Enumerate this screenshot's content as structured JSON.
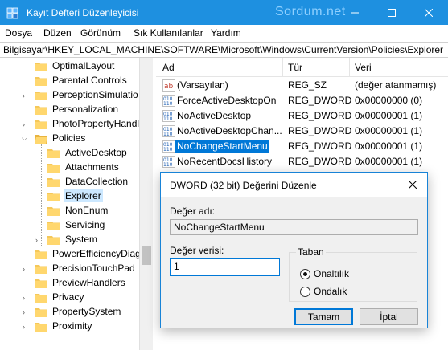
{
  "window": {
    "title": "Kayıt Defteri Düzenleyicisi",
    "watermark": "Sordum.net"
  },
  "menu": [
    "Dosya",
    "Düzen",
    "Görünüm",
    "Sık Kullanılanlar",
    "Yardım"
  ],
  "address": "Bilgisayar\\HKEY_LOCAL_MACHINE\\SOFTWARE\\Microsoft\\Windows\\CurrentVersion\\Policies\\Explorer",
  "tree": {
    "items": [
      {
        "label": "OptimalLayout"
      },
      {
        "label": "Parental Controls"
      },
      {
        "label": "PerceptionSimulatio"
      },
      {
        "label": "Personalization"
      },
      {
        "label": "PhotoPropertyHandl"
      },
      {
        "label": "Policies"
      },
      {
        "label": "ActiveDesktop"
      },
      {
        "label": "Attachments"
      },
      {
        "label": "DataCollection"
      },
      {
        "label": "Explorer"
      },
      {
        "label": "NonEnum"
      },
      {
        "label": "Servicing"
      },
      {
        "label": "System"
      },
      {
        "label": "PowerEfficiencyDiag"
      },
      {
        "label": "PrecisionTouchPad"
      },
      {
        "label": "PreviewHandlers"
      },
      {
        "label": "Privacy"
      },
      {
        "label": "PropertySystem"
      },
      {
        "label": "Proximity"
      }
    ]
  },
  "list": {
    "columns": [
      "Ad",
      "Tür",
      "Veri"
    ],
    "rows": [
      {
        "name": "(Varsayılan)",
        "type": "REG_SZ",
        "data": "(değer atanmamış)",
        "icon": "ab"
      },
      {
        "name": "ForceActiveDesktopOn",
        "type": "REG_DWORD",
        "data": "0x00000000 (0)",
        "icon": "dword"
      },
      {
        "name": "NoActiveDesktop",
        "type": "REG_DWORD",
        "data": "0x00000001 (1)",
        "icon": "dword"
      },
      {
        "name": "NoActiveDesktopChan...",
        "type": "REG_DWORD",
        "data": "0x00000001 (1)",
        "icon": "dword"
      },
      {
        "name": "NoChangeStartMenu",
        "type": "REG_DWORD",
        "data": "0x00000001 (1)",
        "icon": "dword"
      },
      {
        "name": "NoRecentDocsHistory",
        "type": "REG_DWORD",
        "data": "0x00000001 (1)",
        "icon": "dword"
      }
    ]
  },
  "dialog": {
    "title": "DWORD (32 bit) Değerini Düzenle",
    "value_name_label": "Değer adı:",
    "value_name": "NoChangeStartMenu",
    "value_data_label": "Değer verisi:",
    "value_data": "1",
    "base_label": "Taban",
    "base_options": [
      "Onaltılık",
      "Ondalık"
    ],
    "base_selected": "Onaltılık",
    "ok": "Tamam",
    "cancel": "İptal"
  },
  "colors": {
    "titlebar": "#1e90e0",
    "selection": "#0078d7",
    "tree_selection": "#cce8ff",
    "folder": "#f5c85a"
  }
}
